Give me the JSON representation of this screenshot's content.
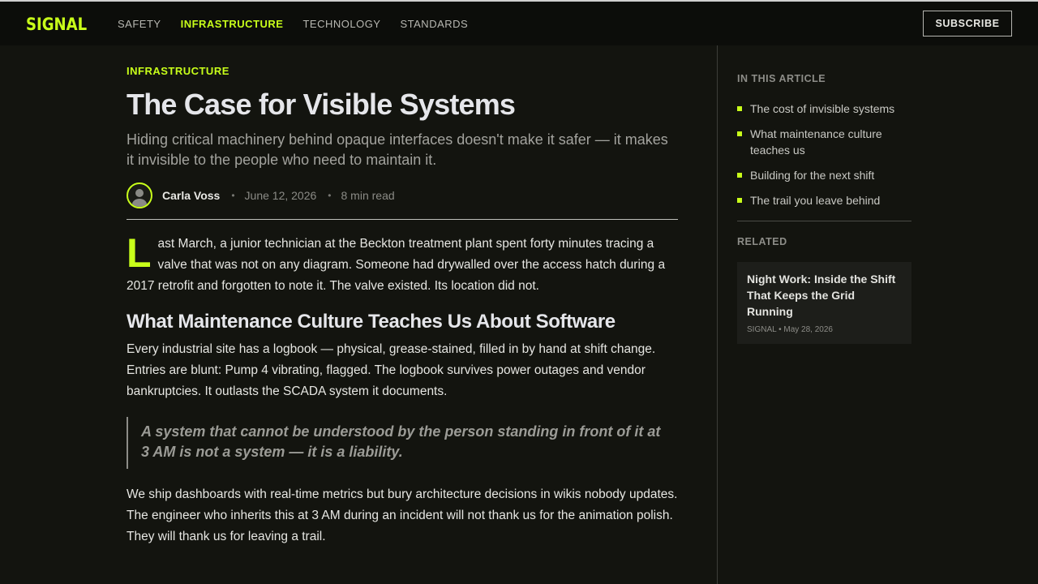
{
  "nav": {
    "logo": "SIGNAL",
    "links": [
      "SAFETY",
      "INFRASTRUCTURE",
      "TECHNOLOGY",
      "STANDARDS"
    ],
    "active_link": "INFRASTRUCTURE",
    "subscribe_label": "SUBSCRIBE"
  },
  "article": {
    "kicker": "INFRASTRUCTURE",
    "headline": "The Case for Visible Systems",
    "dek": "Hiding critical machinery behind opaque interfaces doesn't make it safer — it makes it invisible to the people who need to maintain it.",
    "author": "Carla Voss",
    "date": "June 12, 2026",
    "read_time": "8 min read",
    "dropcap": "L",
    "lead_rest": "ast March, a junior technician at the Beckton treatment plant spent forty minutes tracing a valve that was not on any diagram. Someone had drywalled over the access hatch during a 2017 retrofit and forgotten to note it. The valve existed. Its location did not.",
    "subhead": "What Maintenance Culture Teaches Us About Software",
    "para1": "Every industrial site has a logbook — physical, grease-stained, filled in by hand at shift change. Entries are blunt: Pump 4 vibrating, flagged. The logbook survives power outages and vendor bankruptcies. It outlasts the SCADA system it documents.",
    "quote": "A system that cannot be understood by the person standing in front of it at 3 AM is not a system — it is a liability.",
    "para2": "We ship dashboards with real-time metrics but bury architecture decisions in wikis nobody updates. The engineer who inherits this at 3 AM during an incident will not thank us for the animation polish. They will thank us for leaving a trail."
  },
  "sidebar": {
    "toc_label": "IN THIS ARTICLE",
    "toc": [
      "The cost of invisible systems",
      "What maintenance culture teaches us",
      "Building for the next shift",
      "The trail you leave behind"
    ],
    "related_label": "RELATED",
    "related": {
      "title": "Night Work: Inside the Shift That Keeps the Grid Running",
      "meta": "SIGNAL • May 28, 2026"
    }
  },
  "colors": {
    "accent": "#c8ff1a",
    "background": "#13140f",
    "nav_background": "#0c0d0a"
  },
  "icons": {
    "avatar": "user-avatar-icon",
    "toc_bullet": "square-bullet-icon"
  }
}
